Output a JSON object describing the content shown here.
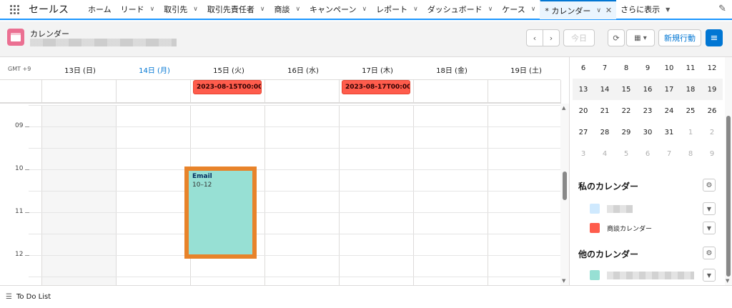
{
  "app": {
    "name": "セールス"
  },
  "nav": {
    "items": [
      {
        "label": "ホーム",
        "chevron": false
      },
      {
        "label": "リード",
        "chevron": true
      },
      {
        "label": "取引先",
        "chevron": true
      },
      {
        "label": "取引先責任者",
        "chevron": true
      },
      {
        "label": "商談",
        "chevron": true
      },
      {
        "label": "キャンペーン",
        "chevron": true
      },
      {
        "label": "レポート",
        "chevron": true
      },
      {
        "label": "ダッシュボード",
        "chevron": true
      },
      {
        "label": "ケース",
        "chevron": true
      }
    ],
    "active_tab": {
      "label": "* カレンダー"
    },
    "more_label": "さらに表示"
  },
  "header": {
    "title": "カレンダー",
    "today_label": "今日",
    "new_event_label": "新規行動"
  },
  "calendar": {
    "timezone": "GMT +9",
    "days": [
      {
        "label": "13日 (日)",
        "today": false
      },
      {
        "label": "14日 (月)",
        "today": true
      },
      {
        "label": "15日 (火)",
        "today": false
      },
      {
        "label": "16日 (水)",
        "today": false
      },
      {
        "label": "17日 (木)",
        "today": false
      },
      {
        "label": "18日 (金)",
        "today": false
      },
      {
        "label": "19日 (土)",
        "today": false
      }
    ],
    "allday_events": [
      {
        "label": "2023-08-15T00:00:...",
        "day_index": 2,
        "color": "#fe5c4c"
      },
      {
        "label": "2023-08-17T00:00:...",
        "day_index": 4,
        "color": "#fe5c4c"
      }
    ],
    "hours": [
      "09",
      "10",
      "11",
      "12"
    ],
    "events": [
      {
        "title": "Email",
        "time": "10–12",
        "day_index": 2,
        "color": "#97e0d4",
        "highlight": "#e8832a"
      }
    ]
  },
  "mini_calendar": {
    "rows": [
      {
        "current": false,
        "days": [
          {
            "d": "6",
            "o": false
          },
          {
            "d": "7",
            "o": false
          },
          {
            "d": "8",
            "o": false
          },
          {
            "d": "9",
            "o": false
          },
          {
            "d": "10",
            "o": false
          },
          {
            "d": "11",
            "o": false
          },
          {
            "d": "12",
            "o": false
          }
        ]
      },
      {
        "current": true,
        "days": [
          {
            "d": "13",
            "o": false
          },
          {
            "d": "14",
            "o": false
          },
          {
            "d": "15",
            "o": false
          },
          {
            "d": "16",
            "o": false
          },
          {
            "d": "17",
            "o": false
          },
          {
            "d": "18",
            "o": false
          },
          {
            "d": "19",
            "o": false
          }
        ]
      },
      {
        "current": false,
        "days": [
          {
            "d": "20",
            "o": false
          },
          {
            "d": "21",
            "o": false
          },
          {
            "d": "22",
            "o": false
          },
          {
            "d": "23",
            "o": false
          },
          {
            "d": "24",
            "o": false
          },
          {
            "d": "25",
            "o": false
          },
          {
            "d": "26",
            "o": false
          }
        ]
      },
      {
        "current": false,
        "days": [
          {
            "d": "27",
            "o": false
          },
          {
            "d": "28",
            "o": false
          },
          {
            "d": "29",
            "o": false
          },
          {
            "d": "30",
            "o": false
          },
          {
            "d": "31",
            "o": false
          },
          {
            "d": "1",
            "o": true
          },
          {
            "d": "2",
            "o": true
          }
        ]
      },
      {
        "current": false,
        "days": [
          {
            "d": "3",
            "o": true
          },
          {
            "d": "4",
            "o": true
          },
          {
            "d": "5",
            "o": true
          },
          {
            "d": "6",
            "o": true
          },
          {
            "d": "7",
            "o": true
          },
          {
            "d": "8",
            "o": true
          },
          {
            "d": "9",
            "o": true
          }
        ]
      }
    ]
  },
  "my_calendars": {
    "title": "私のカレンダー",
    "items": [
      {
        "label": "",
        "color": "#cfe9fe",
        "obscured": true
      },
      {
        "label": "商談カレンダー",
        "color": "#fe5c4c",
        "obscured": false
      }
    ]
  },
  "other_calendars": {
    "title": "他のカレンダー",
    "items": [
      {
        "label": "",
        "color": "#97e0d4",
        "obscured": true
      }
    ]
  },
  "footer": {
    "todo_label": "To Do List"
  }
}
